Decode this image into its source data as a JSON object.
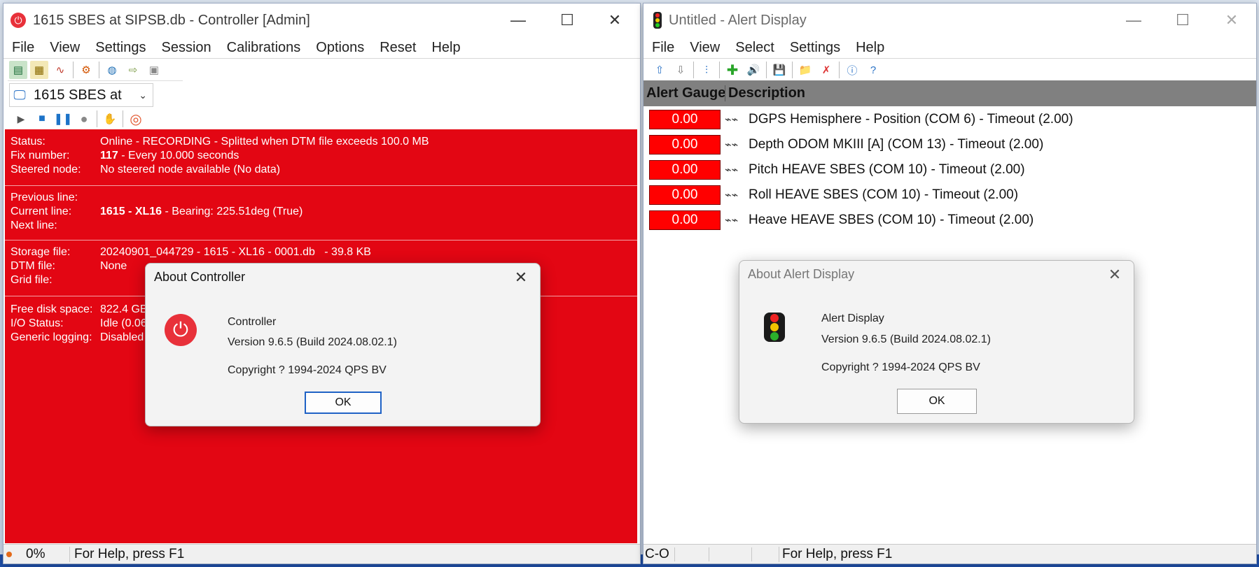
{
  "controller": {
    "title": "1615 SBES at SIPSB.db - Controller [Admin]",
    "menu": [
      "File",
      "View",
      "Settings",
      "Session",
      "Calibrations",
      "Options",
      "Reset",
      "Help"
    ],
    "session_select": "1615 SBES at",
    "status_label": "Status:",
    "status_value": "Online - RECORDING - Splitted when DTM file exceeds 100.0 MB",
    "fix_label": "Fix number:",
    "fix_value_bold": "117",
    "fix_value_rest": " - Every 10.000 seconds",
    "steered_label": "Steered node:",
    "steered_value": "No steered node available (No data)",
    "prev_line_label": "Previous line:",
    "curr_line_label": "Current line:",
    "curr_line_bold": "1615 - XL16",
    "curr_line_rest": " - Bearing: 225.51deg (True)",
    "next_line_label": "Next line:",
    "storage_label": "Storage file:",
    "storage_value": "20240901_044729 - 1615 - XL16 - 0001.db   - 39.8 KB",
    "dtm_label": "DTM file:",
    "dtm_value": "None",
    "grid_label": "Grid file:",
    "disk_label": "Free disk space:",
    "disk_value": "822.4 GB",
    "io_label": "I/O Status:",
    "io_value": "Idle (0.06",
    "logging_label": "Generic logging:",
    "logging_value": "Disabled",
    "status_percent": "0%",
    "status_help": "For Help, press F1",
    "panel_color": "#e30613"
  },
  "about_controller": {
    "title": "About Controller",
    "app_name": "Controller",
    "version": "Version 9.6.5 (Build 2024.08.02.1)",
    "copyright": "Copyright ? 1994-2024 QPS BV",
    "ok": "OK"
  },
  "alert": {
    "title": "Untitled - Alert Display",
    "menu": [
      "File",
      "View",
      "Select",
      "Settings",
      "Help"
    ],
    "col_gauges": "Alert Gauges",
    "col_description": "Description",
    "rows": [
      {
        "value": "0.00",
        "description": "DGPS Hemisphere - Position (COM 6) - Timeout (2.00)"
      },
      {
        "value": "0.00",
        "description": "Depth ODOM MKIII [A] (COM 13) - Timeout (2.00)"
      },
      {
        "value": "0.00",
        "description": "Pitch HEAVE SBES (COM 10) - Timeout (2.00)"
      },
      {
        "value": "0.00",
        "description": "Roll HEAVE SBES (COM 10) - Timeout (2.00)"
      },
      {
        "value": "0.00",
        "description": "Heave HEAVE SBES (COM 10) - Timeout (2.00)"
      }
    ],
    "status_code": "C-O",
    "status_help": "For Help, press F1",
    "gauge_color": "#ff0000"
  },
  "about_alert": {
    "title": "About Alert Display",
    "app_name": "Alert Display",
    "version": "Version 9.6.5 (Build 2024.08.02.1)",
    "copyright": "Copyright ? 1994-2024 QPS BV",
    "ok": "OK"
  }
}
